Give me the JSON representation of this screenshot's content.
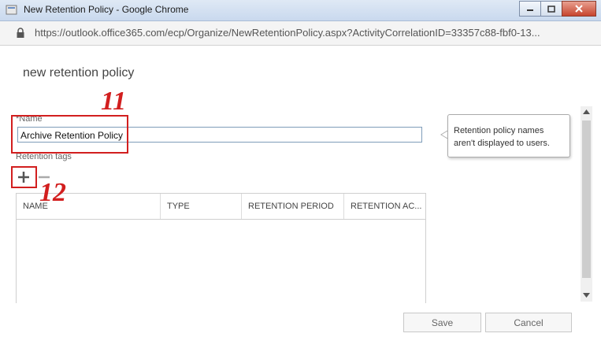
{
  "window": {
    "title": "New Retention Policy - Google Chrome",
    "url": "https://outlook.office365.com/ecp/Organize/NewRetentionPolicy.aspx?ActivityCorrelationID=33357c88-fbf0-13..."
  },
  "dialog": {
    "title": "new retention policy",
    "name_label": "*Name",
    "name_value": "Archive Retention Policy",
    "callout_text": "Retention policy names aren't displayed to users.",
    "tags_label": "Retention tags",
    "grid_columns": [
      "NAME",
      "TYPE",
      "RETENTION PERIOD",
      "RETENTION AC..."
    ],
    "save_label": "Save",
    "cancel_label": "Cancel"
  },
  "annotations": {
    "step_11": "11",
    "step_12": "12",
    "color": "#d21f1f"
  },
  "icons": [
    "chrome-icon",
    "lock-icon",
    "add-icon",
    "remove-icon",
    "minimize-icon",
    "maximize-icon",
    "close-icon"
  ]
}
